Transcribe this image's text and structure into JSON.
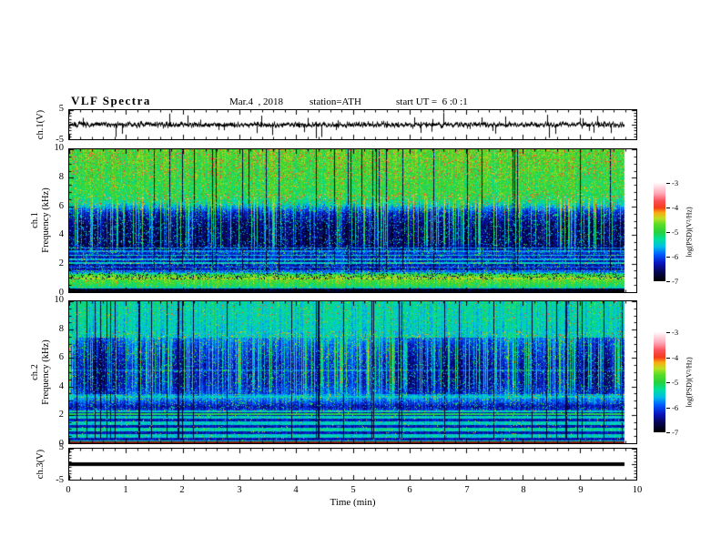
{
  "figure": {
    "background": "#ffffff",
    "title": "VLF Spectra",
    "date": "Mar.4  , 2018",
    "station": "station=ATH",
    "start_ut": "start UT =  6 :0 :1"
  },
  "xaxis": {
    "label": "Time (min)",
    "range": [
      0,
      10
    ],
    "major_ticks": [
      0,
      1,
      2,
      3,
      4,
      5,
      6,
      7,
      8,
      9,
      10
    ],
    "minor_tick_step": 0.2
  },
  "colorbar": {
    "label": "log(PSD)(V²/Hz)",
    "ticks": [
      -3,
      -4,
      -5,
      -6,
      -7
    ],
    "range": [
      -7,
      -3
    ]
  },
  "colormap": {
    "range": [
      -7,
      -3
    ],
    "stops": [
      [
        0.0,
        [
          0,
          0,
          0
        ]
      ],
      [
        0.09,
        [
          5,
          5,
          80
        ]
      ],
      [
        0.18,
        [
          10,
          20,
          190
        ]
      ],
      [
        0.27,
        [
          0,
          90,
          255
        ]
      ],
      [
        0.35,
        [
          0,
          190,
          230
        ]
      ],
      [
        0.43,
        [
          0,
          225,
          150
        ]
      ],
      [
        0.5,
        [
          40,
          210,
          60
        ]
      ],
      [
        0.58,
        [
          90,
          220,
          40
        ]
      ],
      [
        0.64,
        [
          190,
          225,
          35
        ]
      ],
      [
        0.7,
        [
          250,
          170,
          20
        ]
      ],
      [
        0.75,
        [
          245,
          60,
          25
        ]
      ],
      [
        0.82,
        [
          250,
          80,
          90
        ]
      ],
      [
        0.9,
        [
          255,
          170,
          185
        ]
      ],
      [
        1.0,
        [
          255,
          247,
          250
        ]
      ]
    ]
  },
  "chart_data": [
    {
      "id": "ch1_waveform",
      "type": "line",
      "ylabel": "ch.1(V)",
      "ylim": [
        -5,
        5
      ],
      "yticks": [
        5,
        -5
      ],
      "y_minor_step": 1,
      "y_major_every": 5,
      "x_range": [
        0,
        10
      ],
      "data_end_min": 9.8,
      "signal": {
        "baseline_v": 0,
        "noise_v": 0.35,
        "fuzz_v": 0.5,
        "spike_rate": 0.12,
        "spike_v_min": 0.8,
        "spike_v_max": 4.8
      },
      "description": "Broadband noisy voltage trace centered on 0 V with dense impulsive sferic spikes reaching up to ±5 V, data ends near 9.8 min"
    },
    {
      "id": "ch1_spectrogram",
      "type": "heatmap",
      "ylabel": "ch.1",
      "ylabel2": "Frequency (kHz)",
      "ylim": [
        0,
        10
      ],
      "yticks": [
        0,
        2,
        4,
        6,
        8,
        10
      ],
      "y_minor_step": 0.5,
      "y_major_every": 2,
      "x_range": [
        0,
        10
      ],
      "data_end_min": 9.8,
      "value_range": [
        -7,
        -3
      ],
      "noise": 0.55,
      "profile": [
        [
          0,
          -7
        ],
        [
          0.24,
          -7
        ],
        [
          0.3,
          -5.4
        ],
        [
          0.5,
          -5.05
        ],
        [
          0.75,
          -4.85
        ],
        [
          1.0,
          -4.75
        ],
        [
          1.25,
          -4.8
        ],
        [
          1.38,
          -5.6
        ],
        [
          1.55,
          -6.35
        ],
        [
          2.2,
          -6.3
        ],
        [
          2.75,
          -6.2
        ],
        [
          3.2,
          -6.65
        ],
        [
          4.8,
          -6.6
        ],
        [
          5.6,
          -6.2
        ],
        [
          6.3,
          -5.3
        ],
        [
          6.9,
          -5.0
        ],
        [
          8.0,
          -4.95
        ],
        [
          9.3,
          -4.85
        ],
        [
          10,
          -4.8
        ]
      ],
      "hlines": [
        [
          1.52,
          -5.85
        ],
        [
          1.78,
          -5.9
        ],
        [
          2.08,
          -5.5
        ],
        [
          2.33,
          -5.65
        ],
        [
          2.62,
          -5.6
        ],
        [
          2.9,
          -5.8
        ],
        [
          3.12,
          -5.85
        ],
        [
          0.98,
          -4.55
        ]
      ],
      "streaks": {
        "rate": 0.28,
        "mid_boost": 1.3,
        "dark_rate": 0.05
      },
      "streak_band": [
        2.6,
        6.9
      ],
      "dark_fmin": 1.45,
      "speckle": {
        "cyan_band": [
          1.4,
          6.9
        ],
        "cyan_p": 0.1,
        "yellow_fmin": 6.5,
        "yellow_p": 0.13,
        "red_fmin": 8.0,
        "red_p": 0.05
      },
      "dark_speckle": {
        "band": [
          0.9,
          1.35
        ],
        "p": 0.18
      },
      "extras": [
        {
          "band": [
            0.28,
            1.15
          ],
          "p": 0.045,
          "set": [
            -4.5,
            0.45
          ]
        }
      ],
      "description": "ch.1 VLF spectrogram 0-10 kHz: strong green/yellow PSD (~-4.9) above 6.5 kHz with red bursts (~-4) near 10 kHz, deep navy background (~-6.6) from 3-6 kHz crossed by vertical green sferic streaks and cyan speckle, cyan hum lines near 1.5-3.1 kHz, bright green band (~-4.8) 0.3-1.3 kHz, black (-7) below 0.25 kHz"
    },
    {
      "id": "ch2_spectrogram",
      "type": "heatmap",
      "ylabel": "ch.2",
      "ylabel2": "Frequency (kHz)",
      "ylim": [
        0,
        10
      ],
      "yticks": [
        0,
        2,
        4,
        6,
        8,
        10
      ],
      "y_minor_step": 0.5,
      "y_major_every": 2,
      "x_range": [
        0,
        10
      ],
      "data_end_min": 9.8,
      "value_range": [
        -7,
        -3
      ],
      "noise": 0.5,
      "profile": [
        [
          0,
          -7
        ],
        [
          0.16,
          -7
        ],
        [
          0.2,
          -6.0
        ],
        [
          2.35,
          -6.1
        ],
        [
          2.6,
          -6.35
        ],
        [
          3.0,
          -5.9
        ],
        [
          3.25,
          -5.65
        ],
        [
          3.6,
          -5.8
        ],
        [
          4.2,
          -6.0
        ],
        [
          5.5,
          -6.0
        ],
        [
          6.8,
          -5.75
        ],
        [
          7.5,
          -5.5
        ],
        [
          8.6,
          -5.4
        ],
        [
          10,
          -5.35
        ]
      ],
      "stripes": {
        "fmin": 0.18,
        "fmax": 2.35,
        "period": 0.22,
        "hi": -5.45,
        "lo": -6.3
      },
      "hlines": [
        [
          2.08,
          -5.05
        ],
        [
          3.32,
          -5.55
        ],
        [
          5.15,
          -5.65
        ],
        [
          1.02,
          -5.2
        ]
      ],
      "streaks": {
        "rate": 0.3,
        "mid_boost": 1.0,
        "dark_rate": 0.06
      },
      "streak_band": [
        3.2,
        7.8
      ],
      "dark_fmin": 0.35,
      "patches": {
        "band": [
          3.5,
          7.5
        ],
        "depth": 0.75
      },
      "speckle": {
        "cyan_band": [
          2.3,
          7.9
        ],
        "cyan_p": 0.09,
        "yellow_fmin": 7.3,
        "yellow_p": 0.06,
        "red_fmin": 8.4,
        "red_p": 0.015
      },
      "extras": [
        {
          "band": [
            0.2,
            2.35
          ],
          "p": 0.02,
          "set": [
            -4.7,
            0.5
          ]
        }
      ],
      "bottom_row_color": "#7a160c",
      "description": "ch.2 VLF spectrogram 0-10 kHz: green/cyan mix (~-5.4) above 7.5 kHz, patchy dark-blue regions (~-6.6) alternating with cyan 3.5-7.5 kHz, thin vertical dark streaks, horizontal green/blue striping below 2.4 kHz with a bright green hum line near 2.1 kHz, black (-7) below 0.2 kHz with a dark-red base line"
    },
    {
      "id": "ch3_waveform",
      "type": "line",
      "ylabel": "ch.3(V)",
      "ylim": [
        -5,
        5
      ],
      "yticks": [
        5,
        -5
      ],
      "y_minor_step": 1,
      "y_major_every": 5,
      "x_range": [
        0,
        10
      ],
      "data_end_min": 9.8,
      "signal": {
        "baseline_v": 0,
        "flat": true,
        "thickness_px": 4
      },
      "description": "Flat thick trace at 0 V (no signal / clipped channel) extending from 0 to ~9.8 min"
    }
  ]
}
